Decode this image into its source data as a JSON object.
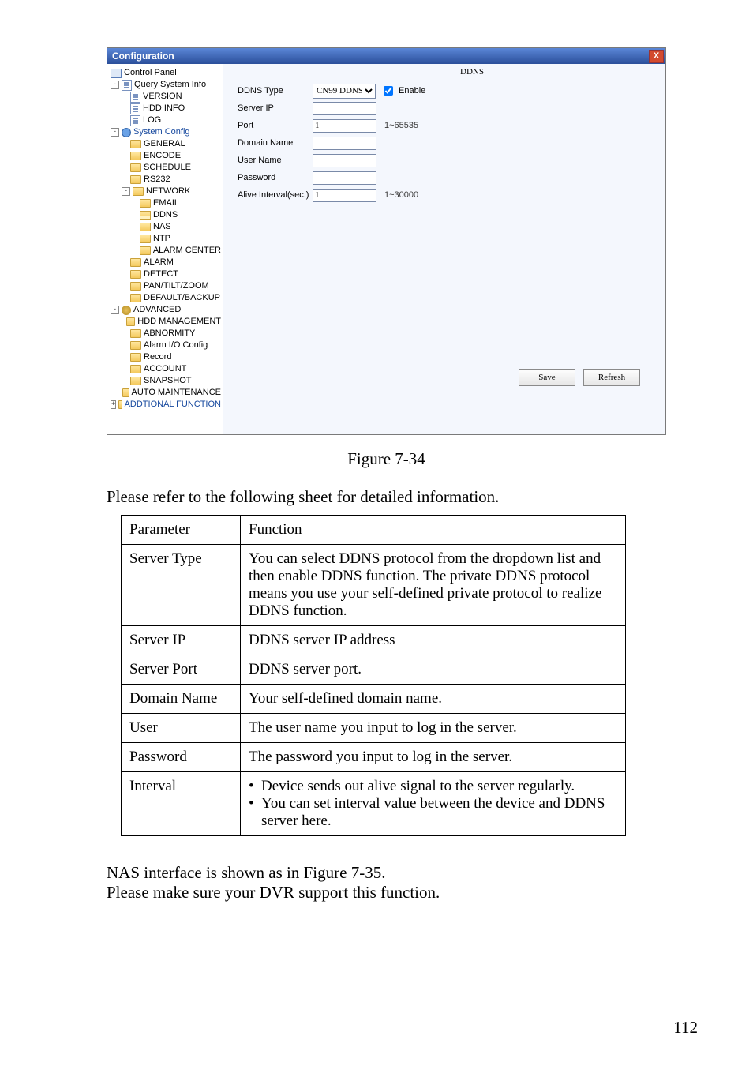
{
  "app": {
    "title": "Configuration",
    "tree": {
      "control_panel": "Control Panel",
      "query_system_info": "Query System Info",
      "version": "VERSION",
      "hdd_info": "HDD INFO",
      "log": "LOG",
      "system_config": "System Config",
      "general": "GENERAL",
      "encode": "ENCODE",
      "schedule": "SCHEDULE",
      "rs232": "RS232",
      "network": "NETWORK",
      "email": "EMAIL",
      "ddns": "DDNS",
      "nas": "NAS",
      "ntp": "NTP",
      "alarm_center": "ALARM CENTER",
      "alarm": "ALARM",
      "detect": "DETECT",
      "ptz": "PAN/TILT/ZOOM",
      "default_backup": "DEFAULT/BACKUP",
      "advanced": "ADVANCED",
      "hdd_mgmt": "HDD MANAGEMENT",
      "abnormity": "ABNORMITY",
      "alarm_io": "Alarm I/O Config",
      "record": "Record",
      "account": "ACCOUNT",
      "snapshot": "SNAPSHOT",
      "auto_maint": "AUTO MAINTENANCE",
      "addtional_fn": "ADDTIONAL FUNCTION"
    },
    "panel": {
      "group_title": "DDNS",
      "labels": {
        "ddns_type": "DDNS Type",
        "server_ip": "Server IP",
        "port": "Port",
        "domain_name": "Domain Name",
        "user_name": "User Name",
        "password": "Password",
        "alive_interval": "Alive Interval(sec.)",
        "enable": "Enable"
      },
      "values": {
        "ddns_type": "CN99 DDNS",
        "server_ip": "",
        "port": "1",
        "domain_name": "",
        "user_name": "",
        "password": "",
        "alive_interval": "1",
        "enable_checked": true
      },
      "hints": {
        "port": "1~65535",
        "alive_interval": "1~30000"
      },
      "buttons": {
        "save": "Save",
        "refresh": "Refresh"
      }
    }
  },
  "figure_caption": "Figure 7-34",
  "intro_text": "Please refer to the following sheet for detailed information.",
  "table": {
    "head": {
      "param": "Parameter",
      "func": "Function"
    },
    "rows": [
      {
        "p": "Server Type",
        "f": "You can select DDNS protocol from the dropdown list and then enable DDNS function. The private DDNS protocol means you use your self-defined private protocol to realize DDNS function."
      },
      {
        "p": "Server IP",
        "f": "DDNS server IP address"
      },
      {
        "p": "Server Port",
        "f": "DDNS server port."
      },
      {
        "p": "Domain Name",
        "f": "Your self-defined domain name."
      },
      {
        "p": "User",
        "f": "The user name you input to log in the server."
      },
      {
        "p": "Password",
        "f": "The password you input to log in the server."
      }
    ],
    "interval": {
      "p": "Interval",
      "b1": "Device sends out alive signal to the server regularly.",
      "b2": "You can set interval value between the device and DDNS server here."
    }
  },
  "footer": {
    "l1": "NAS interface is shown as in Figure 7-35.",
    "l2": "Please make sure your DVR support this function."
  },
  "page_number": "112"
}
